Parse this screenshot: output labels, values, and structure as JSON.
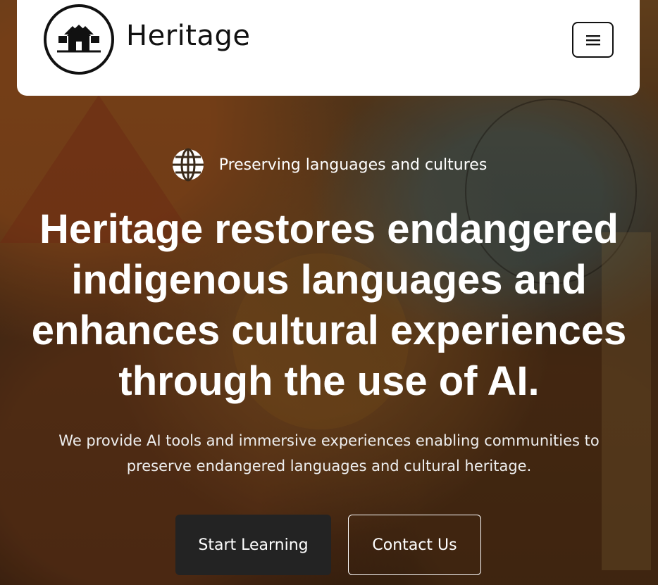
{
  "header": {
    "brand_name": "Heritage",
    "logo_icon": "hut-logo-icon",
    "menu_icon": "hamburger-menu-icon"
  },
  "hero": {
    "tagline_icon": "globe-icon",
    "tagline": "Preserving languages and cultures",
    "headline": "Heritage restores endangered indigenous languages and enhances cultural experiences through the use of AI.",
    "subtitle": "We provide AI tools and immersive experiences enabling communities to preserve endangered languages and cultural heritage.",
    "primary_button_label": "Start Learning",
    "secondary_button_label": "Contact Us"
  },
  "colors": {
    "navbar_bg": "#ffffff",
    "primary_button_bg": "#232323",
    "text_on_hero": "#ffffff"
  }
}
